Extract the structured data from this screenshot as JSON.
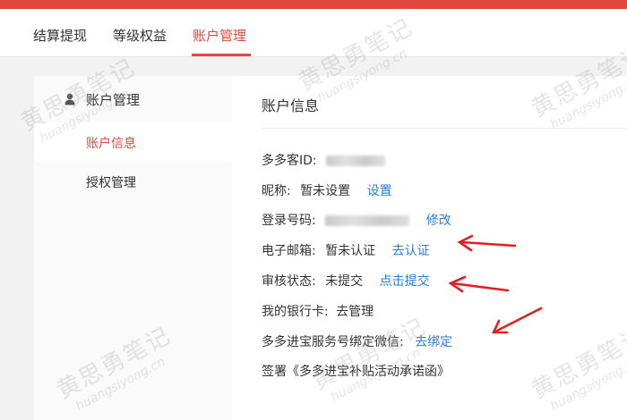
{
  "tabs": [
    {
      "label": "结算提现"
    },
    {
      "label": "等级权益"
    },
    {
      "label": "账户管理"
    }
  ],
  "sidebar": {
    "title": "账户管理",
    "items": [
      {
        "label": "账户信息"
      },
      {
        "label": "授权管理"
      }
    ]
  },
  "main": {
    "title": "账户信息",
    "rows": {
      "id": {
        "label": "多多客ID:"
      },
      "nickname": {
        "label": "昵称:",
        "value": "暂未设置",
        "link": "设置"
      },
      "login": {
        "label": "登录号码:",
        "link": "修改"
      },
      "email": {
        "label": "电子邮箱:",
        "value": "暂未认证",
        "link": "去认证"
      },
      "audit": {
        "label": "审核状态:",
        "value": "未提交",
        "link": "点击提交"
      },
      "bank": {
        "label": "我的银行卡:",
        "link": "去管理"
      },
      "wechat": {
        "label": "多多进宝服务号绑定微信:",
        "link": "去绑定"
      },
      "sign": {
        "label": "签署《多多进宝补贴活动承诺函》"
      }
    }
  },
  "watermark": {
    "cn": "黄思勇笔记",
    "en": "huangsiyong.cn"
  },
  "colors": {
    "accent": "#e2473f",
    "link": "#2f7dd1",
    "arrow": "#e02020"
  }
}
